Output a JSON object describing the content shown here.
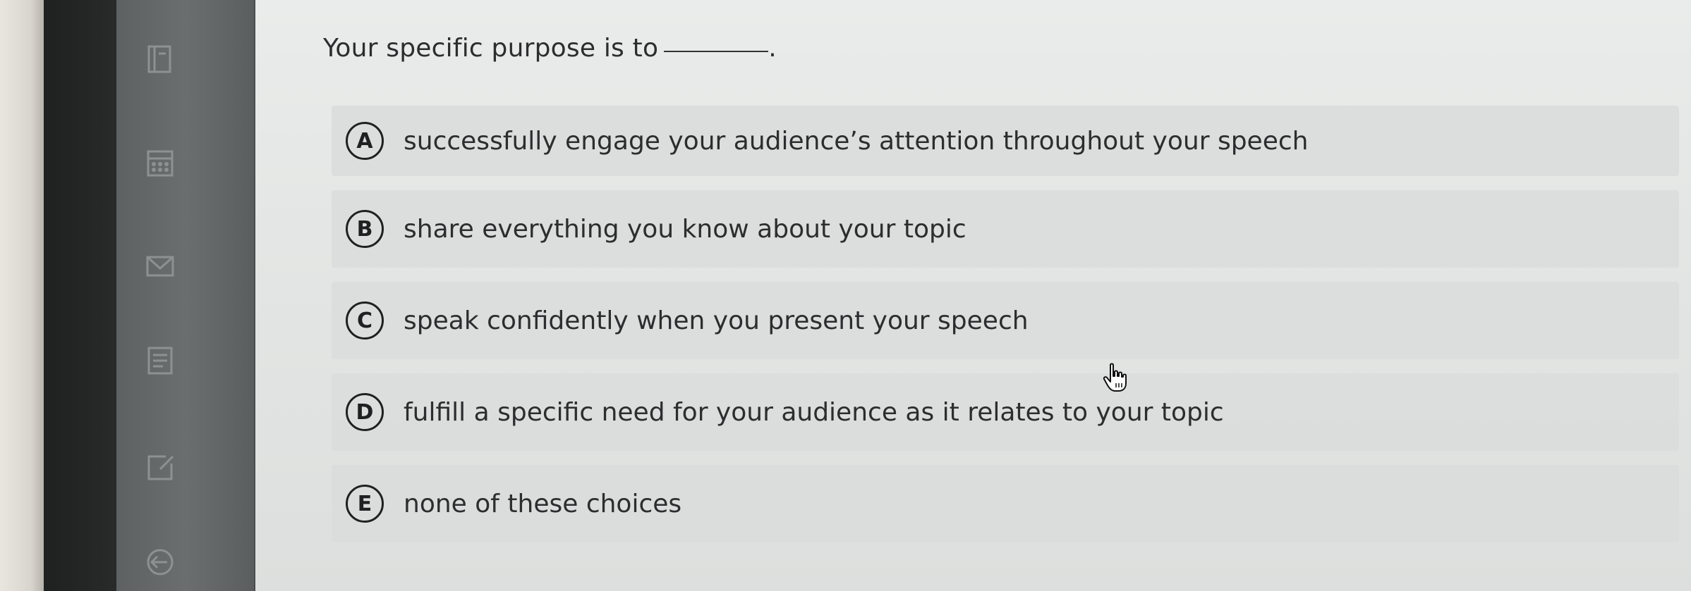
{
  "question": {
    "text": "Your specific purpose is to",
    "suffix": "."
  },
  "choices": [
    {
      "letter": "A",
      "text": "successfully engage your audience’s attention throughout your speech"
    },
    {
      "letter": "B",
      "text": "share everything you know about your topic"
    },
    {
      "letter": "C",
      "text": "speak confidently when you present your speech"
    },
    {
      "letter": "D",
      "text": "fulfill a specific need for your audience as it relates to your topic"
    },
    {
      "letter": "E",
      "text": "none of these choices"
    }
  ],
  "icons": {
    "rail": [
      "book-icon",
      "calculator-icon",
      "mail-icon",
      "document-icon",
      "edit-icon",
      "back-icon"
    ],
    "cursor": "hand-pointer-icon"
  },
  "colors": {
    "text": "#2b2d2e",
    "badge_border": "#1e2021",
    "choice_background": "#dadddc"
  }
}
